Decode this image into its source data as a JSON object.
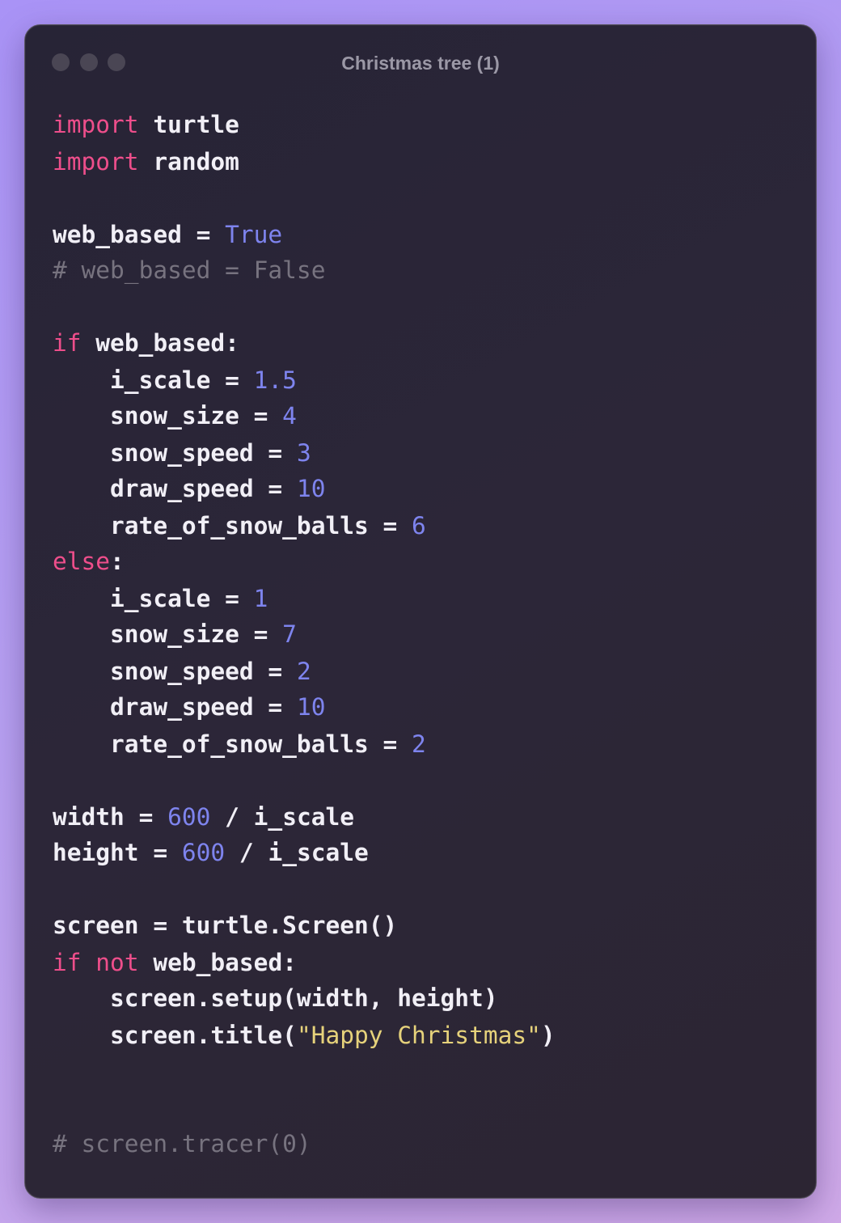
{
  "window": {
    "title": "Christmas tree (1)"
  },
  "colors": {
    "keyword": "#ee4e8b",
    "number": "#7e84ee",
    "string": "#e6d27b",
    "comment": "#77737f",
    "text": "#f1eff6",
    "background": "#272436"
  },
  "code": {
    "l1_kw": "import",
    "l1_rest": " turtle",
    "l2_kw": "import",
    "l2_rest": " random",
    "l4_a": "web_based = ",
    "l4_val": "True",
    "l5_cmt": "# web_based = False",
    "l7_kw": "if",
    "l7_rest": " web_based:",
    "l8_a": "    i_scale = ",
    "l8_val": "1.5",
    "l9_a": "    snow_size = ",
    "l9_val": "4",
    "l10_a": "    snow_speed = ",
    "l10_val": "3",
    "l11_a": "    draw_speed = ",
    "l11_val": "10",
    "l12_a": "    rate_of_snow_balls = ",
    "l12_val": "6",
    "l13_kw": "else",
    "l13_rest": ":",
    "l14_a": "    i_scale = ",
    "l14_val": "1",
    "l15_a": "    snow_size = ",
    "l15_val": "7",
    "l16_a": "    snow_speed = ",
    "l16_val": "2",
    "l17_a": "    draw_speed = ",
    "l17_val": "10",
    "l18_a": "    rate_of_snow_balls = ",
    "l18_val": "2",
    "l20_a": "width = ",
    "l20_val": "600",
    "l20_b": " / i_scale",
    "l21_a": "height = ",
    "l21_val": "600",
    "l21_b": " / i_scale",
    "l23_a": "screen = turtle.Screen()",
    "l24_kw1": "if",
    "l24_sp": " ",
    "l24_kw2": "not",
    "l24_rest": " web_based:",
    "l25_a": "    screen.setup(width, height)",
    "l26_a": "    screen.title(",
    "l26_str": "\"Happy Christmas\"",
    "l26_b": ")",
    "l29_cmt": "# screen.tracer(0)"
  }
}
